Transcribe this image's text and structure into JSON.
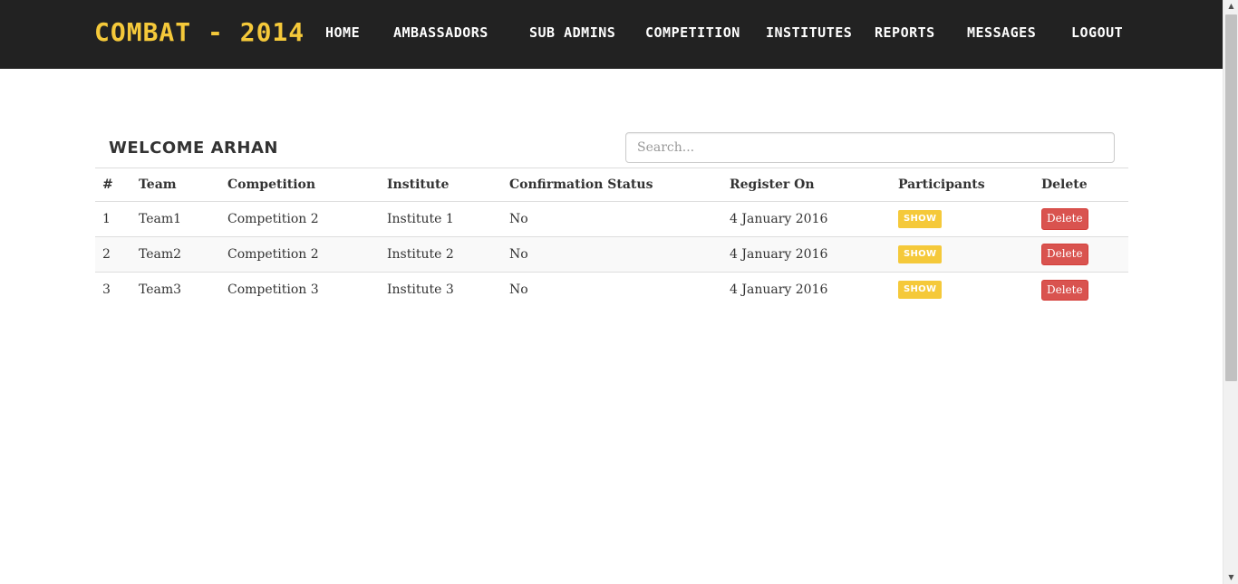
{
  "navbar": {
    "brand": "COMBAT - 2014",
    "links": [
      "HOME",
      "AMBASSADORS",
      "SUB ADMINS",
      "COMPETITION",
      "INSTITUTES",
      "REPORTS",
      "MESSAGES",
      "LOGOUT"
    ]
  },
  "main": {
    "welcome": "WELCOME ARHAN",
    "search_placeholder": "Search..."
  },
  "table": {
    "headers": [
      "#",
      "Team",
      "Competition",
      "Institute",
      "Confirmation Status",
      "Register On",
      "Participants",
      "Delete"
    ],
    "rows": [
      {
        "num": "1",
        "team": "Team1",
        "competition": "Competition 2",
        "institute": "Institute 1",
        "status": "No",
        "registered": "4 January 2016",
        "participants": "SHOW",
        "delete": "Delete"
      },
      {
        "num": "2",
        "team": "Team2",
        "competition": "Competition 2",
        "institute": "Institute 2",
        "status": "No",
        "registered": "4 January 2016",
        "participants": "SHOW",
        "delete": "Delete"
      },
      {
        "num": "3",
        "team": "Team3",
        "competition": "Competition 3",
        "institute": "Institute 3",
        "status": "No",
        "registered": "4 January 2016",
        "participants": "SHOW",
        "delete": "Delete"
      }
    ]
  },
  "colors": {
    "navbar_bg": "#222222",
    "brand": "#f5c93a",
    "show_button": "#f5c93a",
    "delete_button": "#d9534f",
    "status_no": "#e3120b"
  },
  "icons": {
    "scroll_up": "▲",
    "scroll_down": "▼"
  }
}
